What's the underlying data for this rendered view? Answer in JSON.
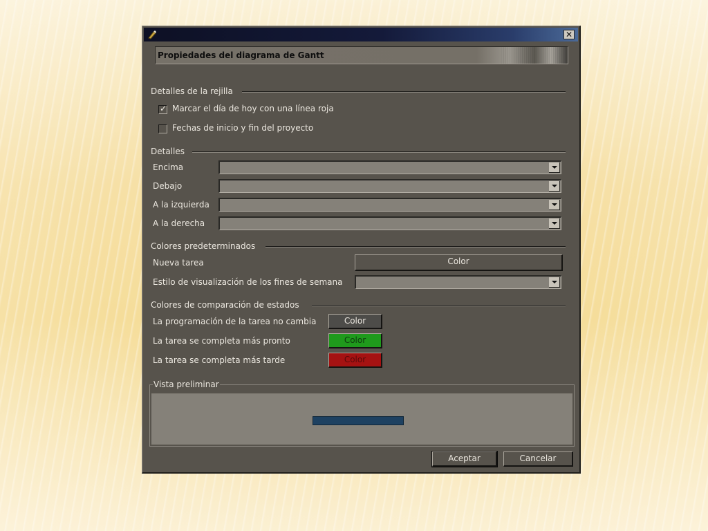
{
  "window": {
    "title_text": "",
    "close_label": "✕",
    "header_title": "Propiedades del diagrama de Gantt"
  },
  "grid_details": {
    "section_label": "Detalles de la rejilla",
    "options": [
      {
        "label": "Marcar el día de hoy con una línea roja",
        "checked": true
      },
      {
        "label": "Fechas de inicio y fin del proyecto",
        "checked": false
      }
    ]
  },
  "details": {
    "section_label": "Detalles",
    "fields": [
      {
        "label": "Encima",
        "value": ""
      },
      {
        "label": "Debajo",
        "value": ""
      },
      {
        "label": "A la izquierda",
        "value": ""
      },
      {
        "label": "A la derecha",
        "value": ""
      }
    ]
  },
  "default_colors": {
    "section_label": "Colores predeterminados",
    "new_task_label": "Nueva tarea",
    "new_task_button": "Color",
    "weekend_label": "Estilo de visualización de los fines de semana",
    "weekend_value": ""
  },
  "status_colors": {
    "section_label": "Colores de comparación de estados",
    "rows": [
      {
        "label": "La programación de la tarea no cambia",
        "button": "Color",
        "color": "#4d4c49"
      },
      {
        "label": "La tarea se completa más pronto",
        "button": "Color",
        "color": "#1f9a1c"
      },
      {
        "label": "La tarea se completa más tarde",
        "button": "Color",
        "color": "#a51212"
      }
    ]
  },
  "preview": {
    "label": "Vista preliminar",
    "bar_color": "#1e4161"
  },
  "footer": {
    "ok_label": "Aceptar",
    "cancel_label": "Cancelar"
  }
}
